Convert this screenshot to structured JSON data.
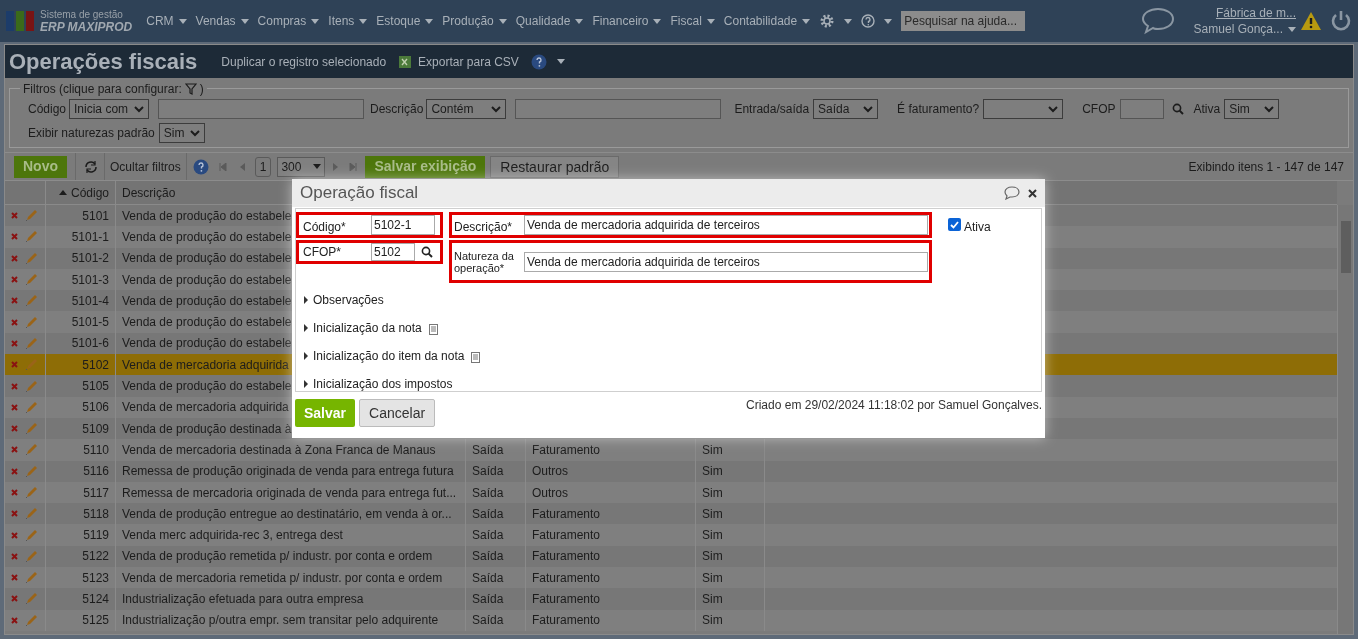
{
  "nav": {
    "logo_top": "Sistema de gestão",
    "logo_bottom": "ERP MAXIPROD",
    "menus": [
      "CRM",
      "Vendas",
      "Compras",
      "Itens",
      "Estoque",
      "Produção",
      "Qualidade",
      "Financeiro",
      "Fiscal",
      "Contabilidade"
    ],
    "search": {
      "placeholder": "Pesquisar na ajuda..."
    },
    "company": "Fábrica de m...",
    "user": "Samuel Gonça..."
  },
  "page": {
    "title": "Operações fiscais",
    "actions": [
      "Duplicar o registro selecionado",
      "Exportar para CSV"
    ]
  },
  "filters": {
    "legend": "Filtros (clique para configurar:",
    "legend_end": ")",
    "fields": [
      {
        "kind": "select_text",
        "label": "Código",
        "value": "Inicia com"
      },
      {
        "kind": "select_text",
        "label": "Descrição",
        "value": "Contém"
      },
      {
        "kind": "select",
        "label": "Entrada/saída",
        "value": "Saída"
      },
      {
        "kind": "select",
        "label": "É faturamento?"
      },
      {
        "kind": "lookup",
        "label": "CFOP"
      },
      {
        "kind": "select",
        "label": "Ativa",
        "value": "Sim"
      },
      {
        "kind": "select",
        "label": "Exibir naturezas padrão",
        "value": "Sim"
      }
    ]
  },
  "toolbar": {
    "new": "Novo",
    "hide_filters": "Ocultar filtros",
    "page": "1",
    "page_size": "300",
    "save_view": "Salvar exibição",
    "restore": "Restaurar padrão",
    "status": "Exibindo itens 1 - 147 de 147"
  },
  "table": {
    "columns": [
      {
        "label": "Código",
        "sorted": true
      },
      {
        "label": "Descrição",
        "sorted": false
      }
    ],
    "rows": [
      {
        "code": "5101",
        "description": "Venda de produção do estabele",
        "selected": false
      },
      {
        "code": "5101-1",
        "description": "Venda de produção do estabele",
        "selected": false
      },
      {
        "code": "5101-2",
        "description": "Venda de produção do estabele",
        "selected": false
      },
      {
        "code": "5101-3",
        "description": "Venda de produção do estabele",
        "selected": false
      },
      {
        "code": "5101-4",
        "description": "Venda de produção do estabele",
        "selected": false
      },
      {
        "code": "5101-5",
        "description": "Venda de produção do estabele",
        "selected": false
      },
      {
        "code": "5101-6",
        "description": "Venda de produção do estabele",
        "selected": false
      },
      {
        "code": "5102",
        "description": "Venda de mercadoria adquirida",
        "selected": true
      },
      {
        "code": "5105",
        "description": "Venda de produção do estabele",
        "selected": false
      },
      {
        "code": "5106",
        "description": "Venda de mercadoria adquirida",
        "selected": false
      },
      {
        "code": "5109",
        "description": "Venda de produção destinada à",
        "selected": false
      },
      {
        "code": "5110",
        "description": "Venda de mercadoria destinada à Zona Franca de Manaus",
        "direction": "Saída",
        "type": "Faturamento",
        "active": "Sim",
        "selected": false
      },
      {
        "code": "5116",
        "description": "Remessa de produção originada de venda para entrega futura",
        "direction": "Saída",
        "type": "Outros",
        "active": "Sim",
        "selected": false
      },
      {
        "code": "5117",
        "description": "Remessa de mercadoria originada de venda para entrega fut...",
        "direction": "Saída",
        "type": "Outros",
        "active": "Sim",
        "selected": false
      },
      {
        "code": "5118",
        "description": "Venda de produção entregue ao destinatário, em venda à or...",
        "direction": "Saída",
        "type": "Faturamento",
        "active": "Sim",
        "selected": false
      },
      {
        "code": "5119",
        "description": "Venda merc adquirida-rec 3, entrega dest",
        "direction": "Saída",
        "type": "Faturamento",
        "active": "Sim",
        "selected": false
      },
      {
        "code": "5122",
        "description": "Venda de produção remetida p/ industr. por conta e ordem",
        "direction": "Saída",
        "type": "Faturamento",
        "active": "Sim",
        "selected": false
      },
      {
        "code": "5123",
        "description": "Venda de mercadoria remetida p/ industr. por conta e ordem",
        "direction": "Saída",
        "type": "Faturamento",
        "active": "Sim",
        "selected": false
      },
      {
        "code": "5124",
        "description": "Industrialização efetuada para outra empresa",
        "direction": "Saída",
        "type": "Faturamento",
        "active": "Sim",
        "selected": false
      },
      {
        "code": "5125",
        "description": "Industrialização p/outra empr. sem transitar pelo adquirente",
        "direction": "Saída",
        "type": "Faturamento",
        "active": "Sim",
        "selected": false
      }
    ]
  },
  "dialog": {
    "title": "Operação fiscal",
    "code": {
      "label": "Código*",
      "value": "5102-1"
    },
    "description": {
      "label": "Descrição*",
      "value": "Venda de mercadoria adquirida de terceiros"
    },
    "active": {
      "label": "Ativa",
      "checked": true
    },
    "cfop": {
      "label": "CFOP*",
      "value": "5102"
    },
    "nature": {
      "label": "Natureza da operação*",
      "value": "Venda de mercadoria adquirida de terceiros"
    },
    "sections": [
      {
        "label": "Observações",
        "doc_icon": false
      },
      {
        "label": "Inicialização da nota",
        "doc_icon": true
      },
      {
        "label": "Inicialização do item da nota",
        "doc_icon": true
      },
      {
        "label": "Inicialização dos impostos",
        "doc_icon": false
      }
    ],
    "save": "Salvar",
    "cancel": "Cancelar",
    "created": "Criado em 29/02/2024 11:18:02 por Samuel Gonçalves."
  }
}
